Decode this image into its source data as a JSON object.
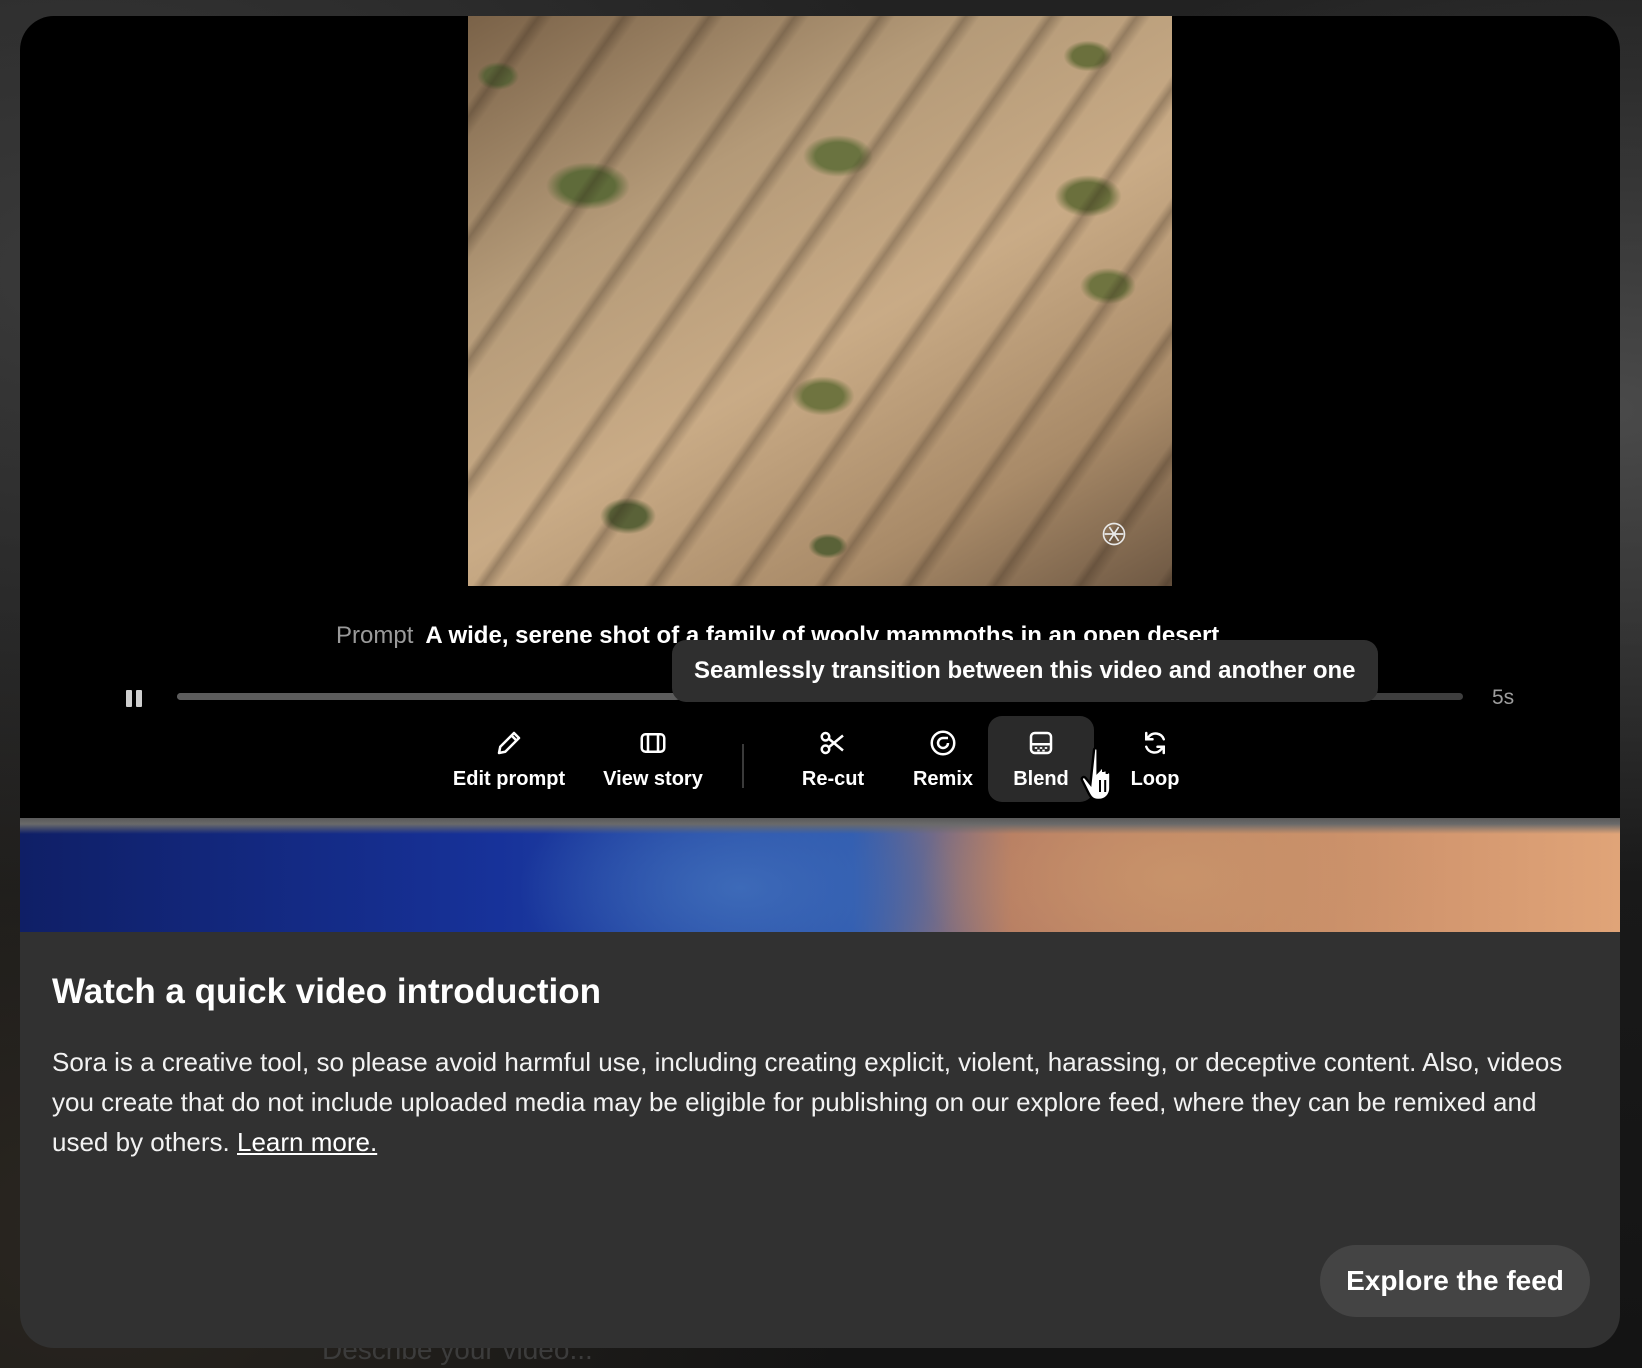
{
  "modal": {
    "prompt_label": "Prompt",
    "prompt_text": "A wide, serene shot of a family of wooly mammoths in an open desert",
    "tooltip": "Seamlessly transition between this video and another one",
    "duration": "5s",
    "progress": 0.39,
    "actions": [
      {
        "label": "Edit prompt",
        "icon": "pencil-icon"
      },
      {
        "label": "View story",
        "icon": "storyboard-icon"
      },
      {
        "label": "Re-cut",
        "icon": "scissors-icon"
      },
      {
        "label": "Remix",
        "icon": "remix-icon"
      },
      {
        "label": "Blend",
        "icon": "blend-icon",
        "active": true
      },
      {
        "label": "Loop",
        "icon": "loop-icon"
      }
    ],
    "intro": {
      "title": "Watch a quick video introduction",
      "body": "Sora is a creative tool, so please avoid harmful use, including creating explicit, violent, harassing, or deceptive content. Also, videos you create that do not include uploaded media may be eligible for publishing on our explore feed, where they can be remixed and used by others. ",
      "link": "Learn more."
    },
    "explore_button": "Explore the feed"
  },
  "background": {
    "input_placeholder": "Describe your video..."
  }
}
